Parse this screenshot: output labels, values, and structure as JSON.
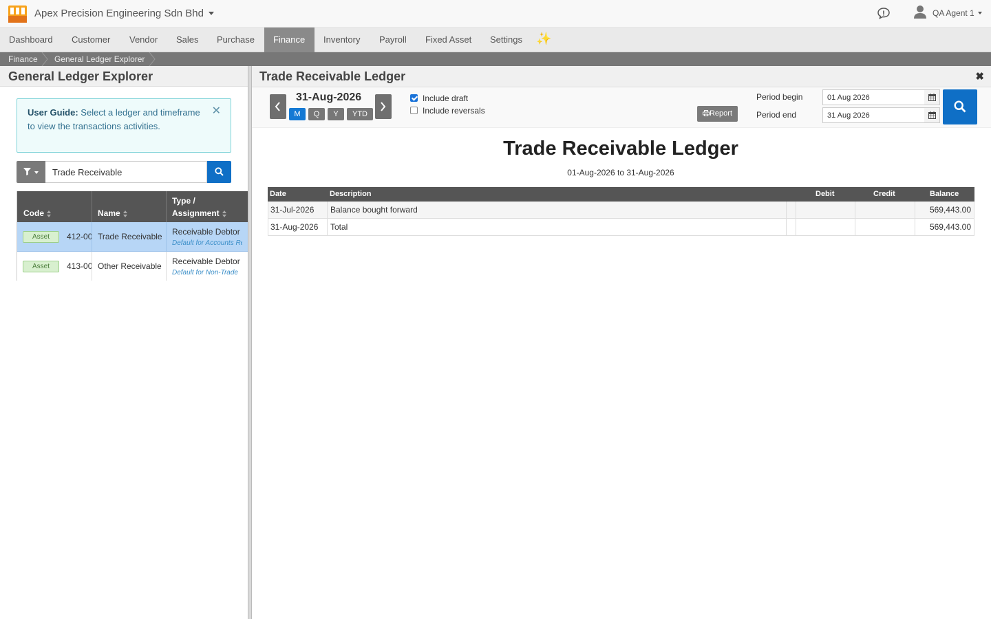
{
  "header": {
    "company": "Apex Precision Engineering Sdn Bhd",
    "user": "QA Agent 1"
  },
  "nav": {
    "items": [
      {
        "label": "Dashboard"
      },
      {
        "label": "Customer"
      },
      {
        "label": "Vendor"
      },
      {
        "label": "Sales"
      },
      {
        "label": "Purchase"
      },
      {
        "label": "Finance",
        "active": true
      },
      {
        "label": "Inventory"
      },
      {
        "label": "Payroll"
      },
      {
        "label": "Fixed Asset"
      },
      {
        "label": "Settings"
      }
    ],
    "sparkle": "✨"
  },
  "breadcrumb": [
    "Finance",
    "General Ledger Explorer"
  ],
  "left": {
    "title": "General Ledger Explorer",
    "guide_bold": "User Guide:",
    "guide_text": " Select a ledger and timeframe to view the transactions activities.",
    "search_value": "Trade Receivable",
    "columns": {
      "code": "Code",
      "name": "Name",
      "type_line1": "Type /",
      "type_line2": "Assignment"
    },
    "rows": [
      {
        "badge": "Asset",
        "code": "412-00",
        "name": "Trade Receivable",
        "type": "Receivable Debtor",
        "assignment": "Default for Accounts Receivable",
        "selected": true
      },
      {
        "badge": "Asset",
        "code": "413-00",
        "name": "Other Receivable",
        "type": "Receivable Debtor",
        "assignment": "Default for Non-Trade",
        "selected": false
      }
    ]
  },
  "right": {
    "title": "Trade Receivable Ledger",
    "current_date": "31-Aug-2026",
    "period_buttons": [
      {
        "label": "M",
        "active": true
      },
      {
        "label": "Q",
        "active": false
      },
      {
        "label": "Y",
        "active": false
      },
      {
        "label": "YTD",
        "active": false
      }
    ],
    "include_draft": {
      "label": "Include draft",
      "checked": true
    },
    "include_reversals": {
      "label": "Include reversals",
      "checked": false
    },
    "report_button": "Report",
    "period_begin_label": "Period begin",
    "period_begin": "01 Aug 2026",
    "period_end_label": "Period end",
    "period_end": "31 Aug 2026",
    "report_title": "Trade Receivable Ledger",
    "report_range": "01-Aug-2026 to 31-Aug-2026",
    "table": {
      "headers": {
        "date": "Date",
        "description": "Description",
        "debit": "Debit",
        "credit": "Credit",
        "balance": "Balance"
      },
      "rows": [
        {
          "date": "31-Jul-2026",
          "description": "Balance bought forward",
          "debit": "",
          "credit": "",
          "balance": "569,443.00"
        },
        {
          "date": "31-Aug-2026",
          "description": "Total",
          "debit": "",
          "credit": "",
          "balance": "569,443.00"
        }
      ]
    }
  },
  "colors": {
    "primary": "#0f6fc6",
    "nav_active": "#8a8a8a",
    "selected_row": "#b7d6f6",
    "badge_bg": "#d8f0cf"
  }
}
